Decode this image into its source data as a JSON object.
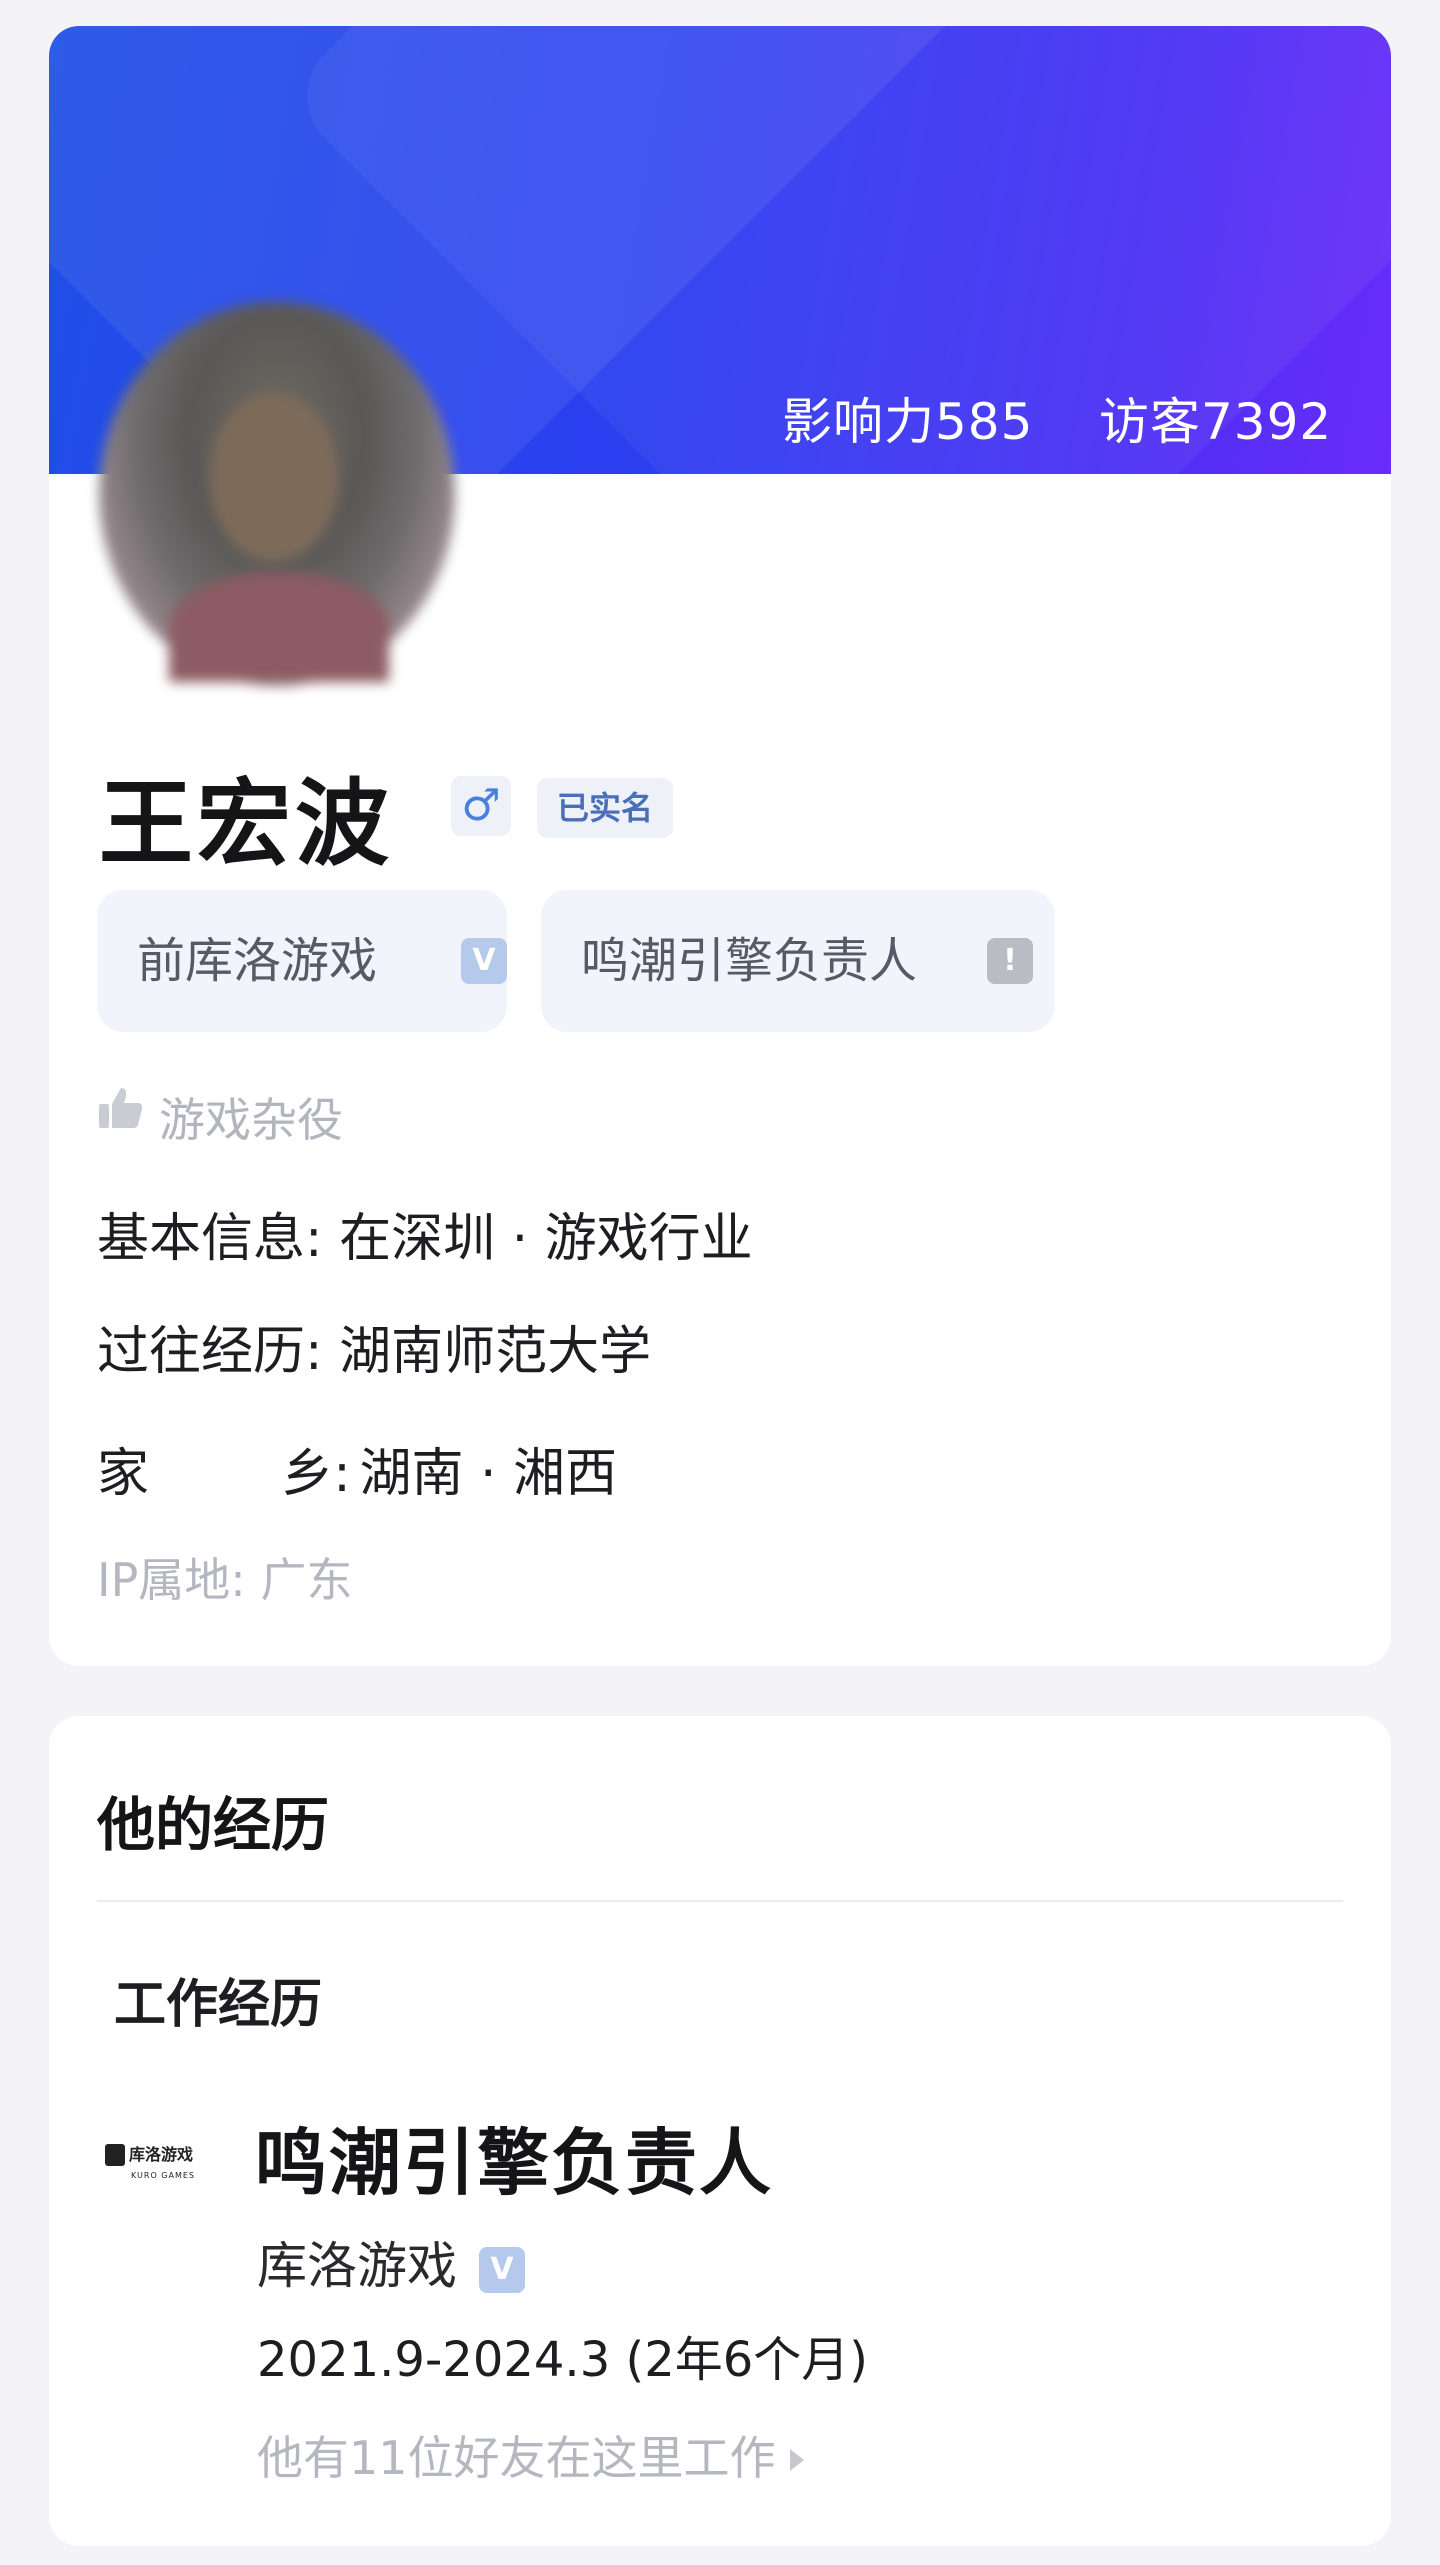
{
  "profile": {
    "stats": {
      "influence_label": "影响力",
      "influence_value": "585",
      "visitors_label": "访客",
      "visitors_value": "7392"
    },
    "name": "王宏波",
    "gender_symbol": "♂",
    "verified_label": "已实名",
    "tags": [
      {
        "label": "前库洛游戏",
        "badge": "V"
      },
      {
        "label": "鸣潮引擎负责人",
        "badge": "!"
      }
    ],
    "motto": "游戏杂役",
    "info": {
      "basic_label": "基本信息:",
      "basic_value": "在深圳 · 游戏行业",
      "experience_label": "过往经历:",
      "experience_value": "湖南师范大学",
      "hometown_label": "家        乡:",
      "hometown_value": "湖南 · 湘西",
      "ip_label": "IP属地:",
      "ip_value": "广东"
    }
  },
  "experience": {
    "section_title": "他的经历",
    "subsection_title": "工作经历",
    "jobs": [
      {
        "logo_text": "库洛游戏",
        "logo_en": "KURO GAMES",
        "title": "鸣潮引擎负责人",
        "company": "库洛游戏",
        "company_badge": "V",
        "dates": "2021.9-2024.3  (2年6个月)",
        "friends": "他有11位好友在这里工作"
      }
    ]
  },
  "colors": {
    "banner_start": "#1f4fe6",
    "banner_end": "#6a2cf8",
    "verified_badge": "#b5c9ec",
    "muted_text": "#b4b7bf"
  }
}
